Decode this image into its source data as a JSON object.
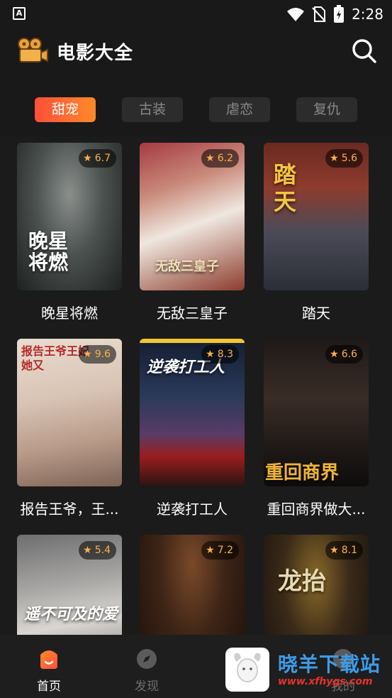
{
  "status_bar": {
    "time": "2:28",
    "notification_icon": "a-icon"
  },
  "header": {
    "title": "电影大全",
    "search_icon": "search-icon"
  },
  "tabs": [
    {
      "label": "甜宠",
      "active": true
    },
    {
      "label": "古装",
      "active": false
    },
    {
      "label": "虐恋",
      "active": false
    },
    {
      "label": "复仇",
      "active": false
    }
  ],
  "movies": [
    {
      "title": "晚星将燃",
      "rating": "6.7",
      "poster_text": "晚星将燃"
    },
    {
      "title": "无敌三皇子",
      "rating": "6.2",
      "poster_text": "无敌三皇子"
    },
    {
      "title": "踏天",
      "rating": "5.6",
      "poster_text": "踏天"
    },
    {
      "title": "报告王爷，王...",
      "rating": "9.6",
      "poster_text": "报告王爷王妃她又"
    },
    {
      "title": "逆袭打工人",
      "rating": "8.3",
      "poster_text": "逆袭打工人"
    },
    {
      "title": "重回商界做大...",
      "rating": "6.6",
      "poster_text": "重回商界"
    },
    {
      "title": "",
      "rating": "5.4",
      "poster_text": "遥不可及的爱"
    },
    {
      "title": "",
      "rating": "7.2",
      "poster_text": ""
    },
    {
      "title": "",
      "rating": "8.1",
      "poster_text": "龙抬"
    }
  ],
  "bottom_nav": [
    {
      "label": "首页",
      "icon": "home-icon",
      "active": true
    },
    {
      "label": "发现",
      "icon": "compass-icon",
      "active": false
    },
    {
      "label": "我的",
      "icon": "profile-icon",
      "active": false
    }
  ],
  "watermark": {
    "name": "晓羊下载站",
    "url": "www.xfhygs.com"
  },
  "colors": {
    "accent_start": "#ff4f3a",
    "accent_end": "#ff8a2a",
    "rating": "#ffb04a",
    "background": "#191919"
  }
}
